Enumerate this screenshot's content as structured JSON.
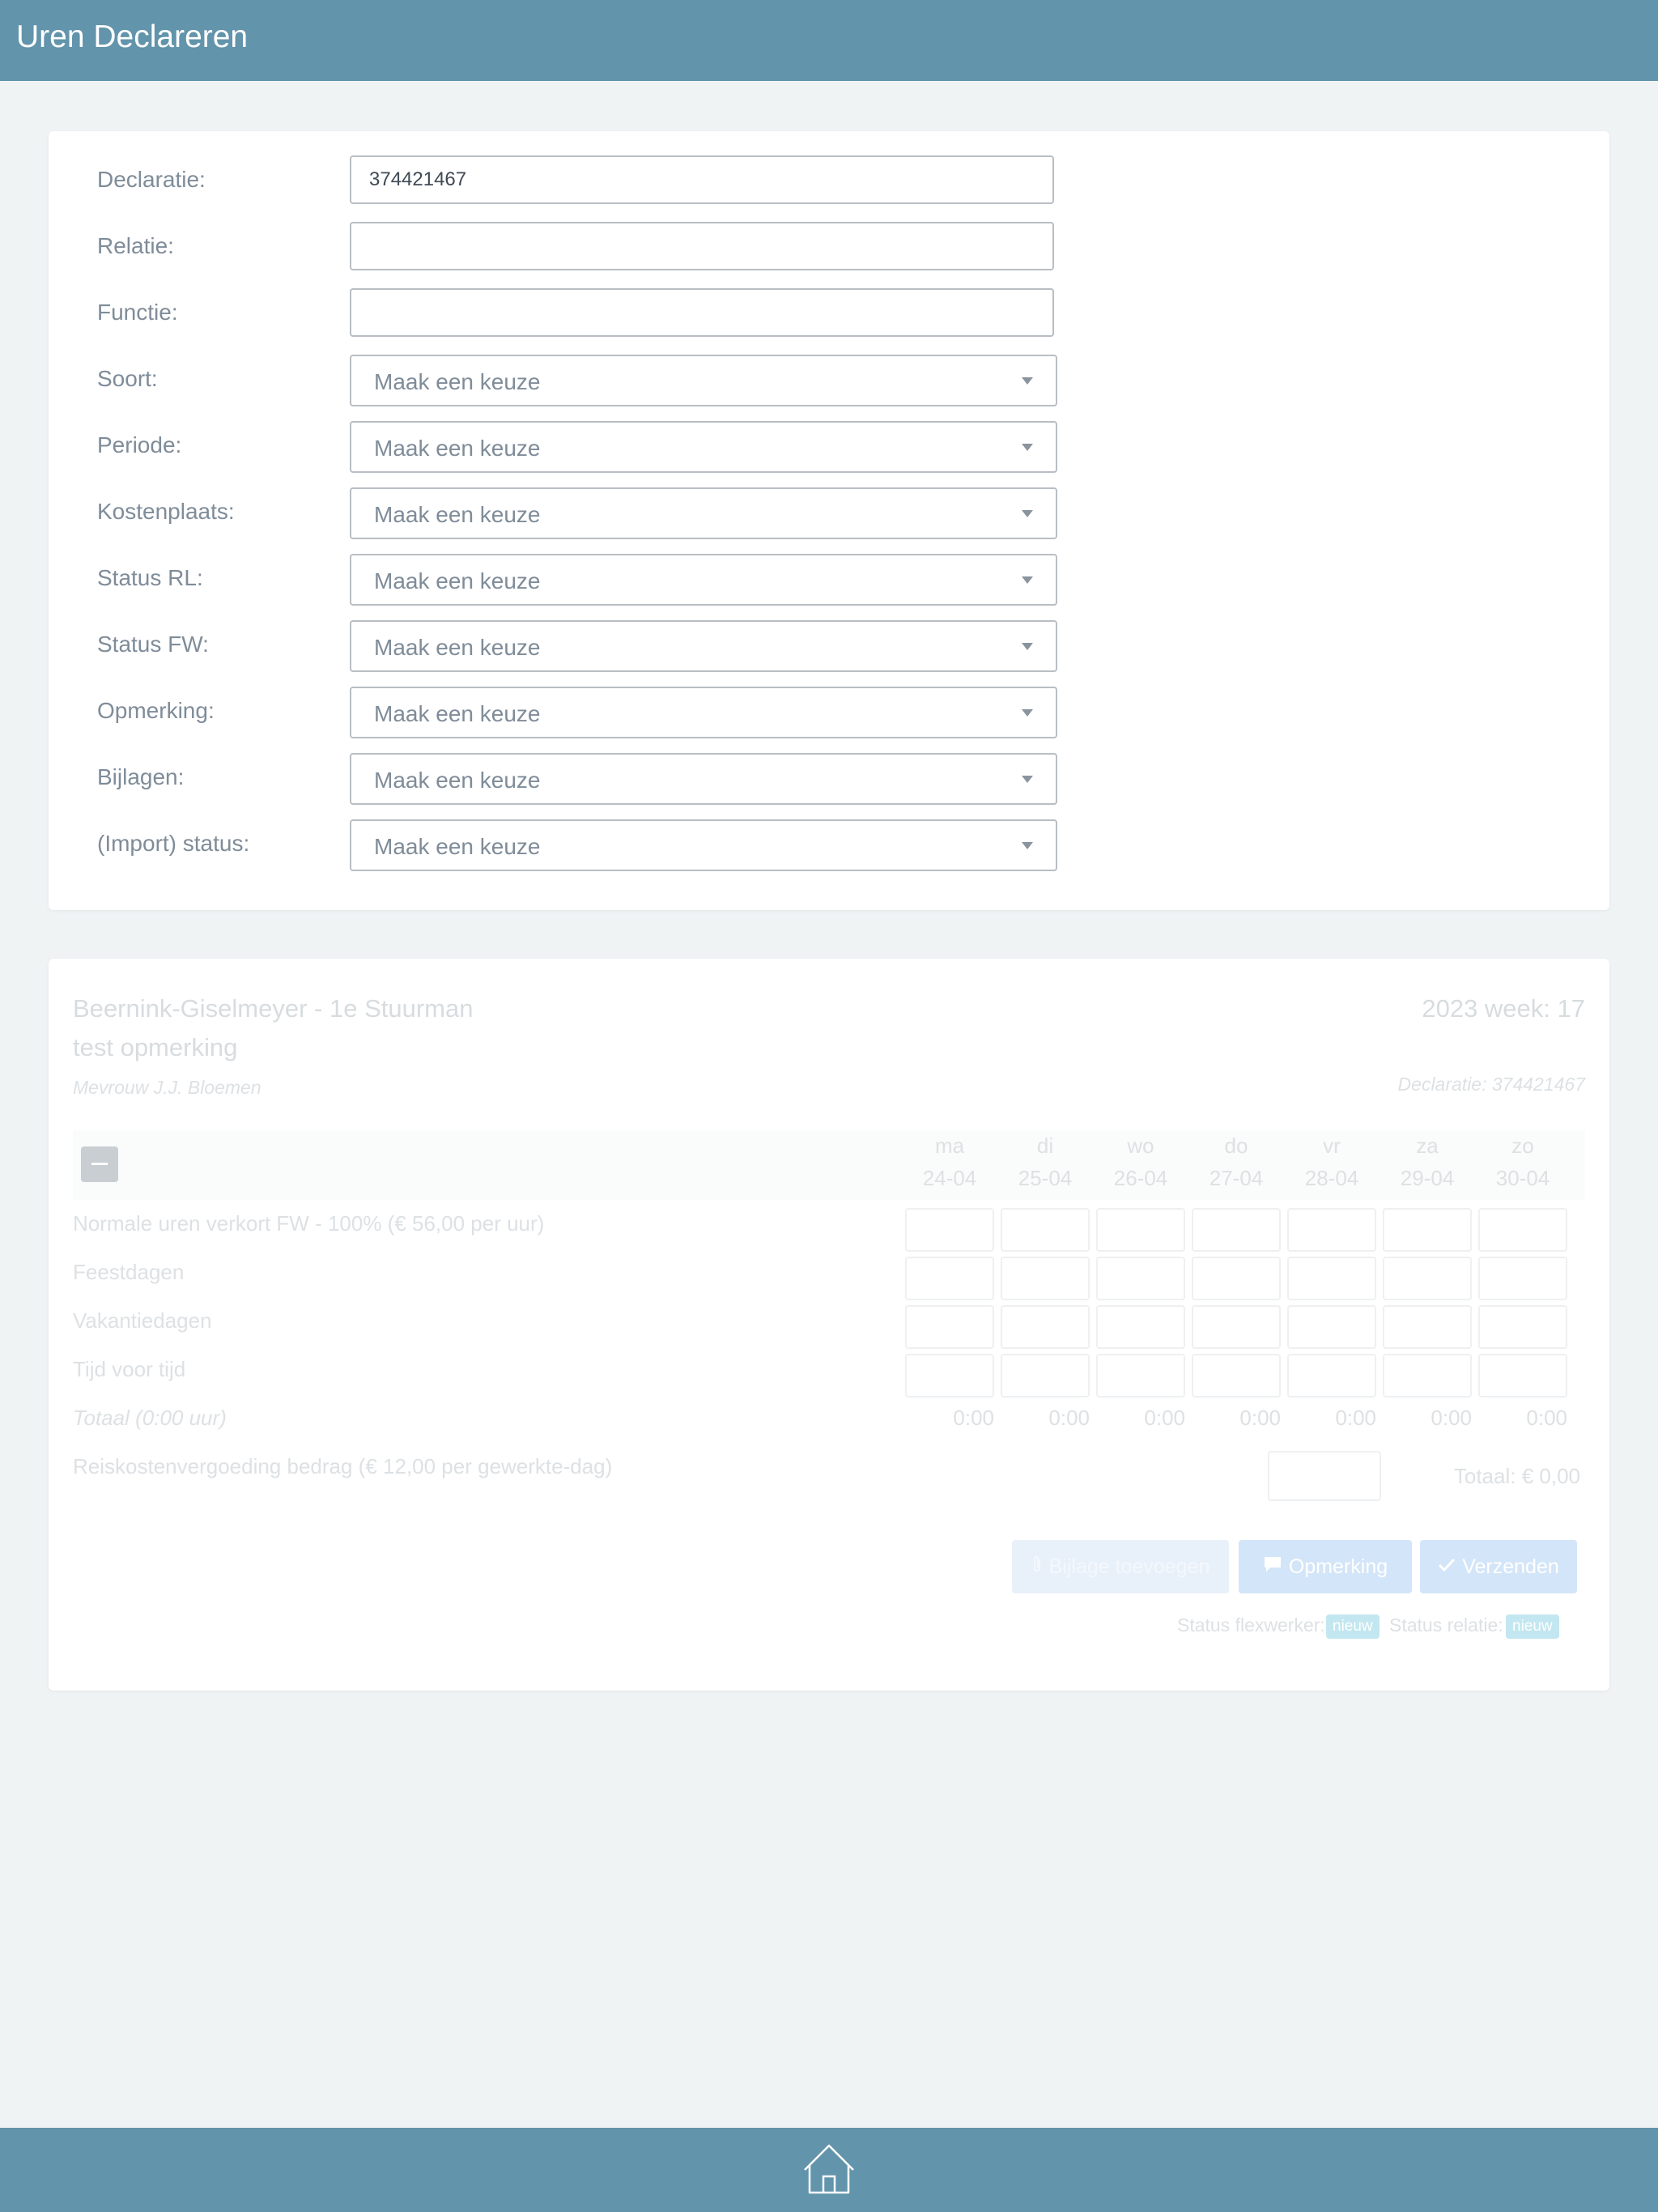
{
  "header": {
    "title": "Uren Declareren"
  },
  "filters": [
    {
      "label": "Declaratie:",
      "type": "input",
      "value": "374421467"
    },
    {
      "label": "Relatie:",
      "type": "input",
      "value": ""
    },
    {
      "label": "Functie:",
      "type": "input",
      "value": ""
    },
    {
      "label": "Soort:",
      "type": "select",
      "value": "Maak een keuze"
    },
    {
      "label": "Periode:",
      "type": "select",
      "value": "Maak een keuze"
    },
    {
      "label": "Kostenplaats:",
      "type": "select",
      "value": "Maak een keuze"
    },
    {
      "label": "Status RL:",
      "type": "select",
      "value": "Maak een keuze"
    },
    {
      "label": "Status FW:",
      "type": "select",
      "value": "Maak een keuze"
    },
    {
      "label": "Opmerking:",
      "type": "select",
      "value": "Maak een keuze"
    },
    {
      "label": "Bijlagen:",
      "type": "select",
      "value": "Maak een keuze"
    },
    {
      "label": "(Import) status:",
      "type": "select",
      "value": "Maak een keuze"
    }
  ],
  "declaration": {
    "title": "Beernink-Giselmeyer - 1e Stuurman",
    "remark": "test opmerking",
    "person": "Mevrouw J.J. Bloemen",
    "week": "2023 week: 17",
    "number": "Declaratie: 374421467",
    "days": [
      {
        "name": "ma",
        "date": "24-04"
      },
      {
        "name": "di",
        "date": "25-04"
      },
      {
        "name": "wo",
        "date": "26-04"
      },
      {
        "name": "do",
        "date": "27-04"
      },
      {
        "name": "vr",
        "date": "28-04"
      },
      {
        "name": "za",
        "date": "29-04"
      },
      {
        "name": "zo",
        "date": "30-04"
      }
    ],
    "hour_rows": [
      "Normale uren verkort FW - 100% (€ 56,00 per uur)",
      "Feestdagen",
      "Vakantiedagen",
      "Tijd voor tijd"
    ],
    "total_label": "Totaal (0:00 uur)",
    "day_totals": [
      "0:00",
      "0:00",
      "0:00",
      "0:00",
      "0:00",
      "0:00",
      "0:00"
    ],
    "travel_label": "Reiskostenvergoeding bedrag (€ 12,00 per gewerkte-dag)",
    "travel_total": "Totaal: € 0,00",
    "buttons": {
      "attach": "Bijlage toevoegen",
      "remark": "Opmerking",
      "send": "Verzenden"
    },
    "status_flexworker_label": "Status flexwerker:",
    "status_flexworker_value": "nieuw",
    "status_relation_label": "Status relatie:",
    "status_relation_value": "nieuw"
  },
  "colors": {
    "header": "#6294ab",
    "background": "#eff3f4",
    "button_primary_faded": "#d3e5f8",
    "badge": "#c3e7f0"
  },
  "icons": {
    "home": "home-icon",
    "caret": "chevron-down-icon",
    "attach": "paperclip-icon",
    "remark": "comment-icon",
    "send": "check-icon",
    "collapse": "minus-icon"
  }
}
